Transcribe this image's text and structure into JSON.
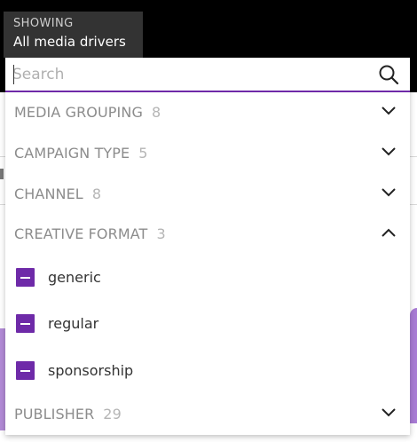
{
  "showing": {
    "label": "SHOWING",
    "value": "All media drivers"
  },
  "search": {
    "placeholder": "Search",
    "value": ""
  },
  "groups": [
    {
      "label": "MEDIA GROUPING",
      "count": "8",
      "expanded": false,
      "icon": "chevron-down-icon"
    },
    {
      "label": "CAMPAIGN TYPE",
      "count": "5",
      "expanded": false,
      "icon": "chevron-down-icon"
    },
    {
      "label": "CHANNEL",
      "count": "8",
      "expanded": false,
      "icon": "chevron-down-icon"
    },
    {
      "label": "CREATIVE FORMAT",
      "count": "3",
      "expanded": true,
      "icon": "chevron-up-icon",
      "options": [
        {
          "label": "generic",
          "state": "indeterminate"
        },
        {
          "label": "regular",
          "state": "indeterminate"
        },
        {
          "label": "sponsorship",
          "state": "indeterminate"
        }
      ]
    },
    {
      "label": "PUBLISHER",
      "count": "29",
      "expanded": false,
      "icon": "chevron-down-icon"
    }
  ],
  "colors": {
    "accent": "#6e2aa8",
    "header_bg": "#333333",
    "chart_purple": "#a87bd4"
  }
}
